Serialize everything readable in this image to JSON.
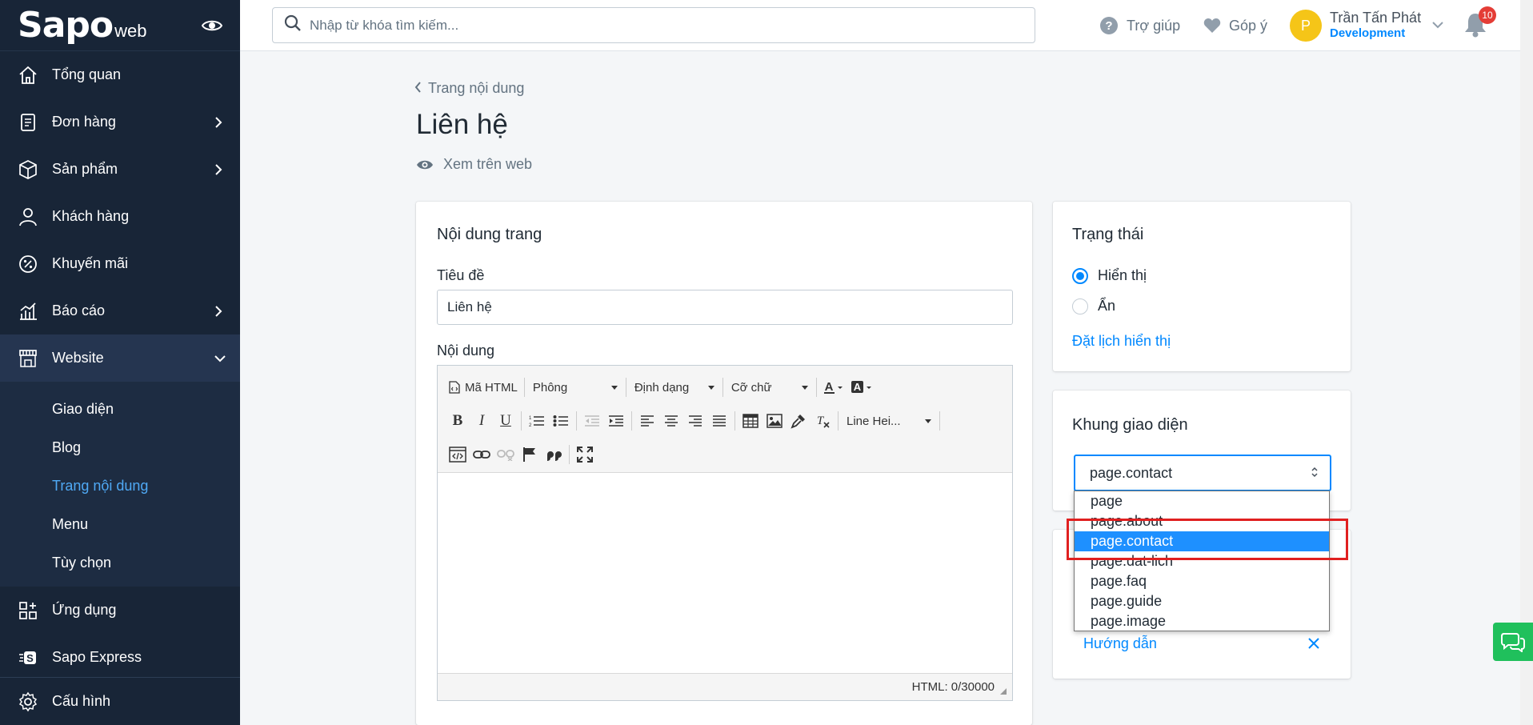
{
  "brand": {
    "logo_main": "Sapo",
    "logo_suffix": "web"
  },
  "sidebar": {
    "items": [
      {
        "label": "Tổng quan"
      },
      {
        "label": "Đơn hàng"
      },
      {
        "label": "Sản phẩm"
      },
      {
        "label": "Khách hàng"
      },
      {
        "label": "Khuyến mãi"
      },
      {
        "label": "Báo cáo"
      },
      {
        "label": "Website"
      }
    ],
    "website_sub": [
      {
        "label": "Giao diện"
      },
      {
        "label": "Blog"
      },
      {
        "label": "Trang nội dung"
      },
      {
        "label": "Menu"
      },
      {
        "label": "Tùy chọn"
      }
    ],
    "more_items": [
      {
        "label": "Ứng dụng"
      },
      {
        "label": "Sapo Express"
      }
    ],
    "settings_label": "Cấu hình"
  },
  "topbar": {
    "search_placeholder": "Nhập từ khóa tìm kiếm...",
    "help_label": "Trợ giúp",
    "feedback_label": "Góp ý",
    "user_initial": "P",
    "user_name": "Trần Tấn Phát",
    "user_role": "Development",
    "notification_count": "10"
  },
  "page": {
    "breadcrumb": "Trang nội dung",
    "title": "Liên hệ",
    "view_on_web": "Xem trên web"
  },
  "content_card": {
    "title": "Nội dung trang",
    "title_label": "Tiêu đề",
    "title_value": "Liên hệ",
    "content_label": "Nội dung",
    "toolbar": {
      "html_code": "Mã HTML",
      "font": "Phông",
      "format": "Định dạng",
      "font_size": "Cỡ chữ",
      "line_height": "Line Hei..."
    },
    "status_text": "HTML: 0/30000"
  },
  "status_card": {
    "title": "Trạng thái",
    "option_show": "Hiển thị",
    "option_hide": "Ẩn",
    "schedule_link": "Đặt lịch hiển thị"
  },
  "template_card": {
    "title": "Khung giao diện",
    "selected": "page.contact",
    "options": [
      "page",
      "page.about",
      "page.contact",
      "page.dat-lich",
      "page.faq",
      "page.guide",
      "page.image"
    ],
    "guide_link": "Hướng dẫn"
  },
  "colors": {
    "sidebar": "#182537",
    "accent": "#0088ff",
    "highlight": "#e02020",
    "chat": "#20c05c"
  }
}
